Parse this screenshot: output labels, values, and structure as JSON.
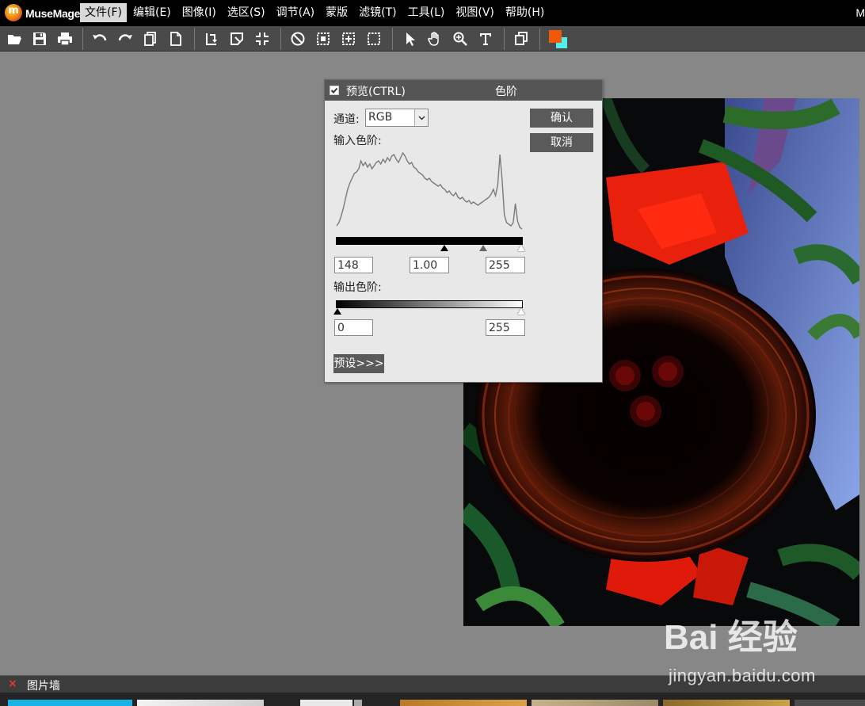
{
  "app": {
    "name": "MuseMage",
    "logo_letter": "m",
    "window_right_text": "M"
  },
  "menu": [
    "文件(F)",
    "编辑(E)",
    "图像(I)",
    "选区(S)",
    "调节(A)",
    "蒙版",
    "滤镜(T)",
    "工具(L)",
    "视图(V)",
    "帮助(H)"
  ],
  "toolbar_icons": [
    "open-icon",
    "save-icon",
    "print-icon",
    "undo-icon",
    "redo-icon",
    "copy-icon",
    "new-icon",
    "rotate-icon",
    "crop-icon",
    "fit-icon",
    "deselect-icon",
    "select-rect-icon",
    "select-move-icon",
    "select-all-icon",
    "pointer-icon",
    "hand-icon",
    "zoom-icon",
    "text-icon",
    "layers-icon"
  ],
  "colors": {
    "foreground": "#ef5a0a",
    "background": "#4ff0ee",
    "menu_active": "#d8d8d8",
    "dialog_title": "#555555"
  },
  "levels_dialog": {
    "preview_label": "预览(CTRL)",
    "title": "色阶",
    "channel_label": "通道:",
    "channel_value": "RGB",
    "input_label": "输入色阶:",
    "output_label": "输出色阶:",
    "ok_label": "确认",
    "cancel_label": "取消",
    "presets_label": "预设>>>",
    "input_black": "148",
    "input_gamma": "1.00",
    "input_white": "255",
    "output_black": "0",
    "output_white": "255",
    "preview_checked": true
  },
  "histogram": [
    6,
    10,
    18,
    28,
    40,
    52,
    60,
    66,
    72,
    74,
    78,
    88,
    82,
    86,
    80,
    84,
    78,
    82,
    86,
    88,
    84,
    90,
    86,
    92,
    88,
    94,
    96,
    90,
    86,
    92,
    98,
    94,
    88,
    84,
    86,
    80,
    78,
    74,
    72,
    70,
    66,
    64,
    66,
    62,
    60,
    58,
    56,
    58,
    54,
    52,
    48,
    50,
    46,
    44,
    48,
    42,
    40,
    42,
    38,
    36,
    38,
    34,
    36,
    34,
    32,
    34,
    36,
    38,
    40,
    42,
    46,
    52,
    44,
    58,
    96,
    64,
    20,
    10,
    8,
    6,
    10,
    34,
    12,
    4,
    2
  ],
  "image_wall": {
    "close_label": "×",
    "title": "图片墙"
  },
  "watermark": {
    "brand": "Bai 经验",
    "url": "jingyan.baidu.com"
  }
}
